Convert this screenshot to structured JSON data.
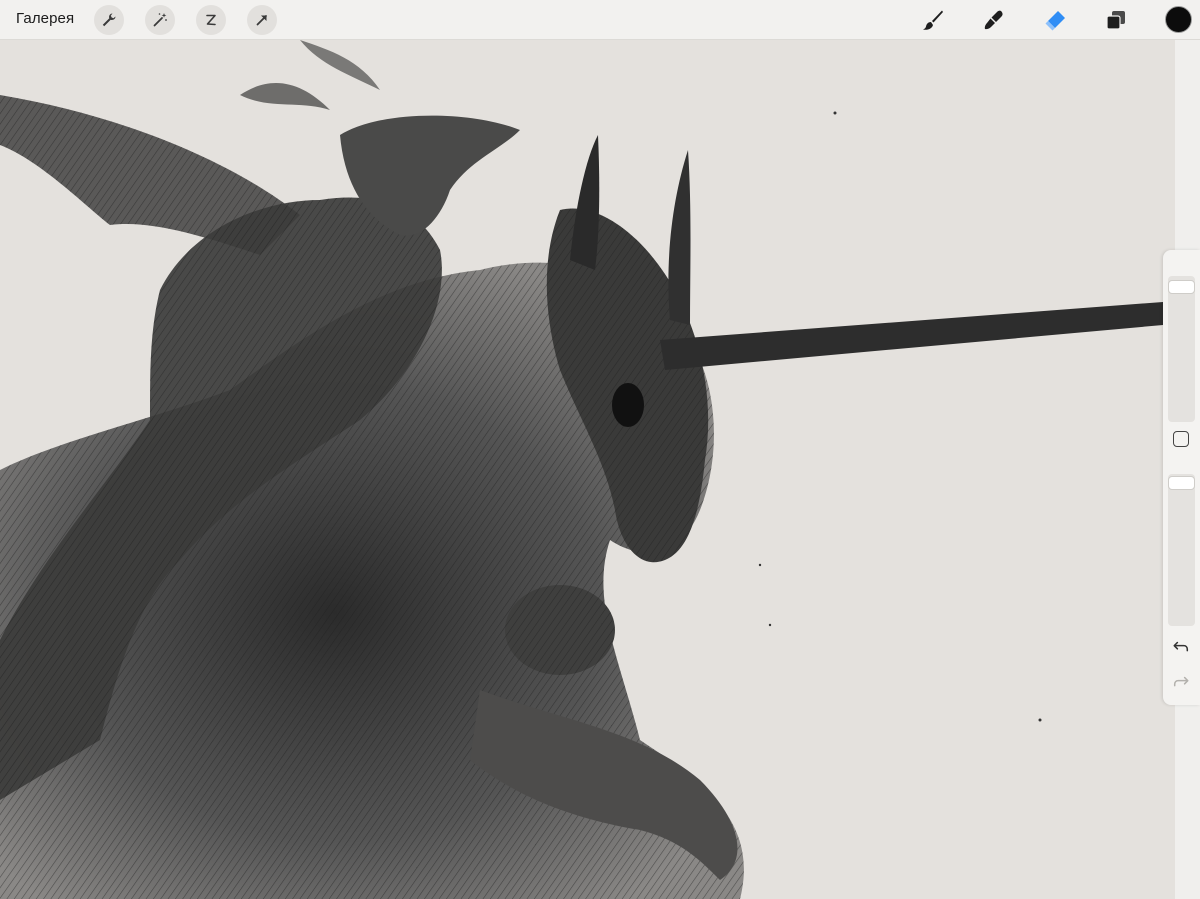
{
  "toolbar": {
    "gallery_label": "Галерея",
    "left_tools": [
      "wrench-icon",
      "magic-wand-icon",
      "selection-icon",
      "transform-arrow-icon"
    ],
    "right_tools": [
      "brush-icon",
      "smudge-icon",
      "eraser-icon",
      "layers-icon"
    ],
    "active_tool": "eraser",
    "active_color": "#0c0c0c",
    "accent_color": "#2f8df5"
  },
  "sidebar": {
    "brush_size_level": 0.04,
    "brush_opacity_level": 0.02,
    "undo_icon": "undo-icon",
    "redo_icon": "redo-icon",
    "modify_icon": "square-icon"
  },
  "canvas": {
    "artwork": "pencil-drawing",
    "paper_color": "#e4e1dd"
  }
}
